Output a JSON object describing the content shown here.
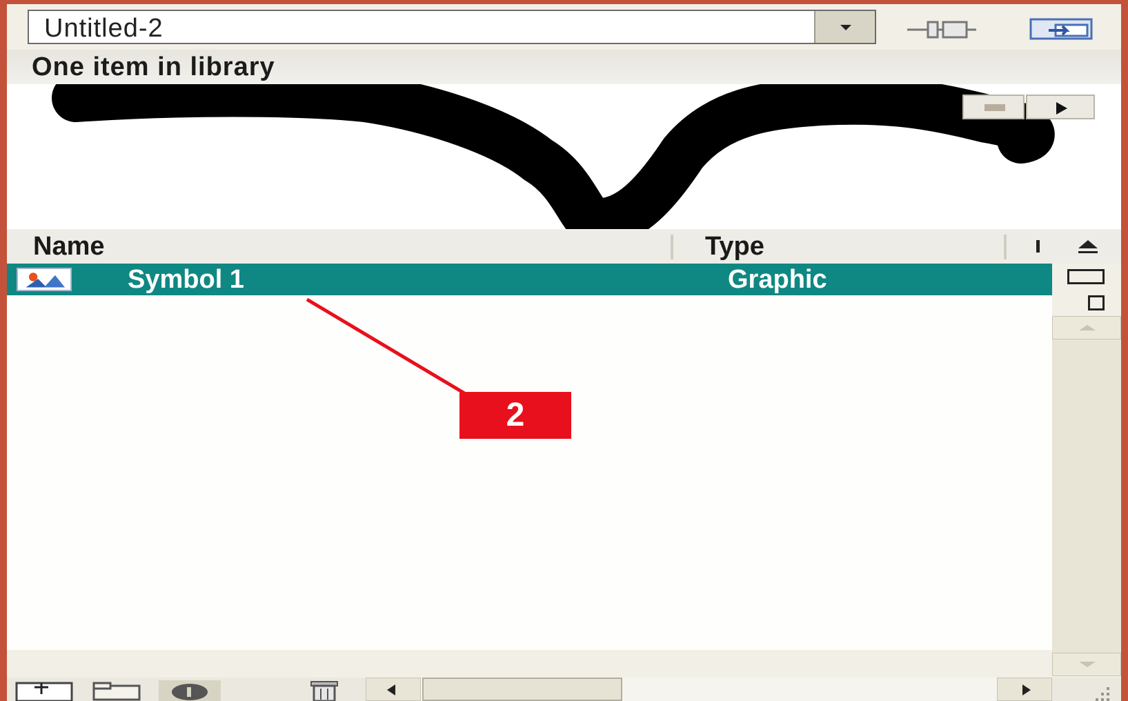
{
  "library": {
    "document_select": {
      "value": "Untitled-2"
    },
    "item_count_label": "One item in library",
    "columns": {
      "name": "Name",
      "type": "Type"
    },
    "items": [
      {
        "name": "Symbol 1",
        "type": "Graphic",
        "icon": "graphic-symbol-icon",
        "selected": true
      }
    ]
  },
  "annotation": {
    "label": "2",
    "color": "#e8101c"
  },
  "colors": {
    "selection": "#0f8883",
    "frame": "#c4523a"
  }
}
